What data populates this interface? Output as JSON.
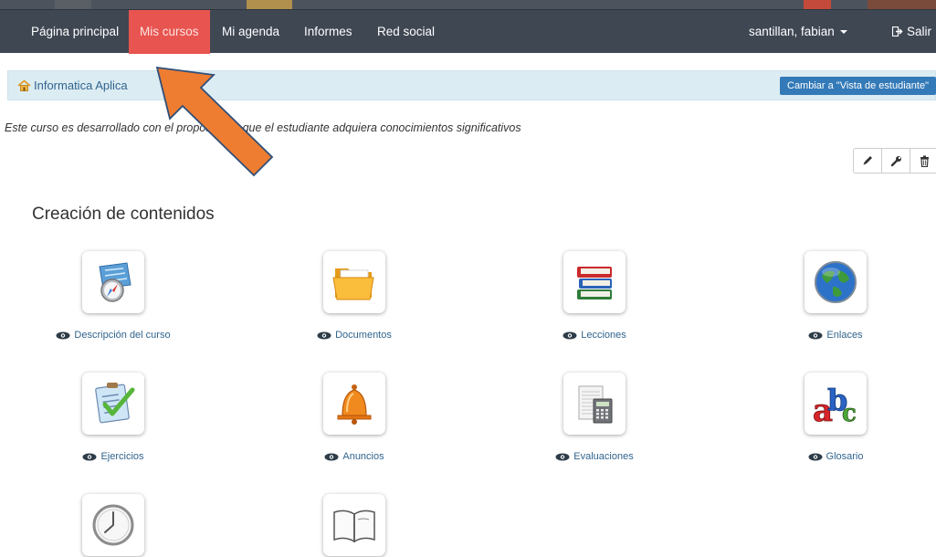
{
  "nav": {
    "items": [
      {
        "label": "Página principal"
      },
      {
        "label": "Mis cursos"
      },
      {
        "label": "Mi agenda"
      },
      {
        "label": "Informes"
      },
      {
        "label": "Red social"
      }
    ],
    "user": "santillan, fabian",
    "logout": "Salir"
  },
  "breadcrumb": {
    "course": "Informatica Aplica",
    "student_view_button": "Cambiar a \"Vista de estudiante\""
  },
  "course_description": "Este curso es desarrollado con el propósito de que el estudiante   adquiera conocimientos  significativos",
  "section": {
    "title": "Creación de contenidos"
  },
  "tools": [
    {
      "label": "Descripción del curso",
      "icon": "compass-map-icon"
    },
    {
      "label": "Documentos",
      "icon": "folder-icon"
    },
    {
      "label": "Lecciones",
      "icon": "books-icon"
    },
    {
      "label": "Enlaces",
      "icon": "globe-icon"
    },
    {
      "label": "Ejercicios",
      "icon": "checklist-icon"
    },
    {
      "label": "Anuncios",
      "icon": "bell-icon"
    },
    {
      "label": "Evaluaciones",
      "icon": "calculator-icon"
    },
    {
      "label": "Glosario",
      "icon": "abc-icon"
    },
    {
      "label": "",
      "icon": "clock-icon"
    },
    {
      "label": "",
      "icon": "open-book-icon"
    }
  ],
  "colors": {
    "navbar": "#3f4753",
    "active_tab": "#e8544f",
    "breadcrumb_bg": "#dcecf3",
    "link": "#31648e",
    "primary_button": "#347ab8",
    "annotation_arrow": "#ee7d31"
  }
}
